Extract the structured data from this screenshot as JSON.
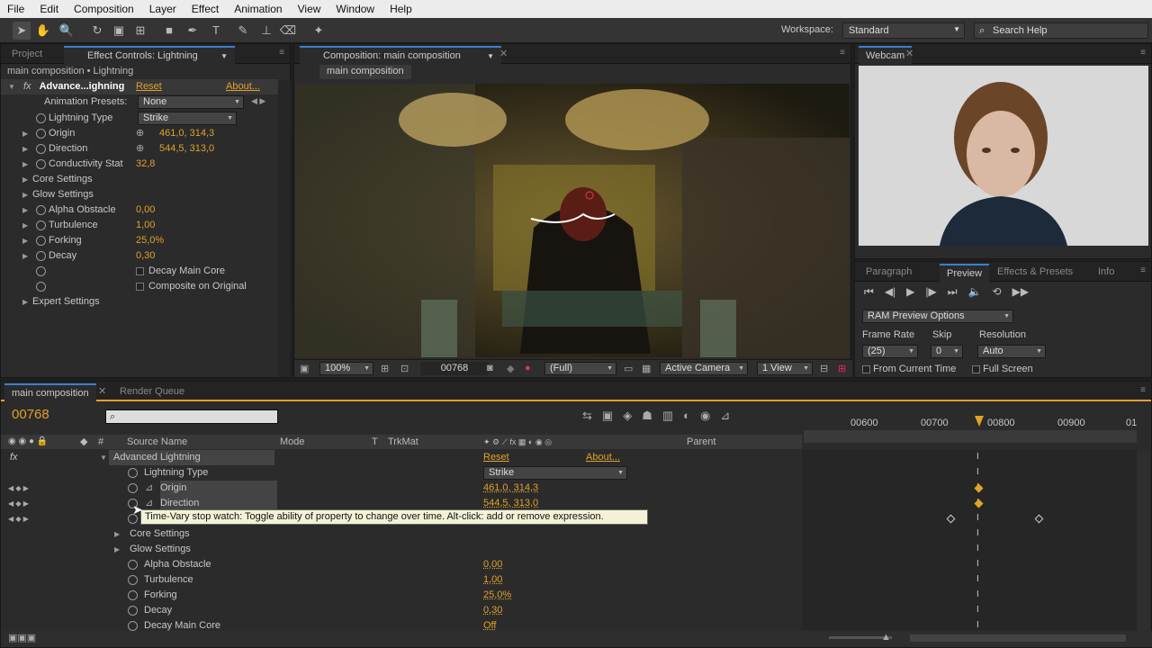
{
  "menu": [
    "File",
    "Edit",
    "Composition",
    "Layer",
    "Effect",
    "Animation",
    "View",
    "Window",
    "Help"
  ],
  "workspace": {
    "label": "Workspace:",
    "value": "Standard"
  },
  "search_help": "Search Help",
  "left_panel": {
    "tabs": [
      "Project",
      "Effect Controls: Lightning"
    ],
    "breadcrumb": "main composition • Lightning",
    "effect_name": "Advance...ighning",
    "reset": "Reset",
    "about": "About...",
    "presets_label": "Animation Presets:",
    "presets_value": "None",
    "rows": [
      {
        "label": "Lightning Type",
        "value": "Strike",
        "kind": "drop"
      },
      {
        "label": "Origin",
        "value": "461,0, 314,3",
        "kind": "point"
      },
      {
        "label": "Direction",
        "value": "544,5, 313,0",
        "kind": "point"
      },
      {
        "label": "Conductivity Stat",
        "value": "32,8",
        "kind": "val"
      },
      {
        "label": "Core Settings",
        "value": "",
        "kind": "group"
      },
      {
        "label": "Glow Settings",
        "value": "",
        "kind": "group"
      },
      {
        "label": "Alpha Obstacle",
        "value": "0,00",
        "kind": "val"
      },
      {
        "label": "Turbulence",
        "value": "1,00",
        "kind": "val"
      },
      {
        "label": "Forking",
        "value": "25,0%",
        "kind": "val"
      },
      {
        "label": "Decay",
        "value": "0,30",
        "kind": "val"
      },
      {
        "label": "Decay Main Core",
        "value": "",
        "kind": "check"
      },
      {
        "label": "Composite on Original",
        "value": "",
        "kind": "check"
      },
      {
        "label": "Expert Settings",
        "value": "",
        "kind": "group"
      }
    ]
  },
  "comp_panel": {
    "tab": "Composition: main composition",
    "crumb": "main composition",
    "zoom": "100%",
    "timecode": "00768",
    "resolution": "(Full)",
    "camera": "Active Camera",
    "views": "1 View"
  },
  "webcam": {
    "tab": "Webcam"
  },
  "preview_panel": {
    "tabs": [
      "Paragraph",
      "Preview",
      "Effects & Presets",
      "Info"
    ],
    "ram": "RAM Preview Options",
    "frame_rate_label": "Frame Rate",
    "skip_label": "Skip",
    "resolution_label": "Resolution",
    "frame_rate": "(25)",
    "skip": "0",
    "resolution": "Auto",
    "from_current": "From Current Time",
    "full_screen": "Full Screen"
  },
  "timeline": {
    "tabs": [
      "main composition",
      "Render Queue"
    ],
    "timecode": "00768",
    "headers": {
      "source": "Source Name",
      "mode": "Mode",
      "t": "T",
      "trkmat": "TrkMat",
      "parent": "Parent"
    },
    "ruler": [
      "00600",
      "00700",
      "00800",
      "00900",
      "01"
    ],
    "layers": [
      {
        "name": "Advanced Lightning",
        "value": "Reset",
        "extra": "About..."
      },
      {
        "name": "Lightning Type",
        "value": "Strike"
      },
      {
        "name": "Origin",
        "value": "461,0, 314,3"
      },
      {
        "name": "Direction",
        "value": "544,5, 313,0"
      },
      {
        "name": "",
        "value": ""
      },
      {
        "name": "Core Settings",
        "value": ""
      },
      {
        "name": "Glow Settings",
        "value": ""
      },
      {
        "name": "Alpha Obstacle",
        "value": "0,00"
      },
      {
        "name": "Turbulence",
        "value": "1,00"
      },
      {
        "name": "Forking",
        "value": "25,0%"
      },
      {
        "name": "Decay",
        "value": "0,30"
      },
      {
        "name": "Decay Main Core",
        "value": "Off"
      }
    ],
    "tooltip": "Time-Vary stop watch: Toggle ability of property to change over time. Alt-click: add or remove expression."
  },
  "colors": {
    "accent": "#e0a22a",
    "bg": "#2b2b2b"
  }
}
